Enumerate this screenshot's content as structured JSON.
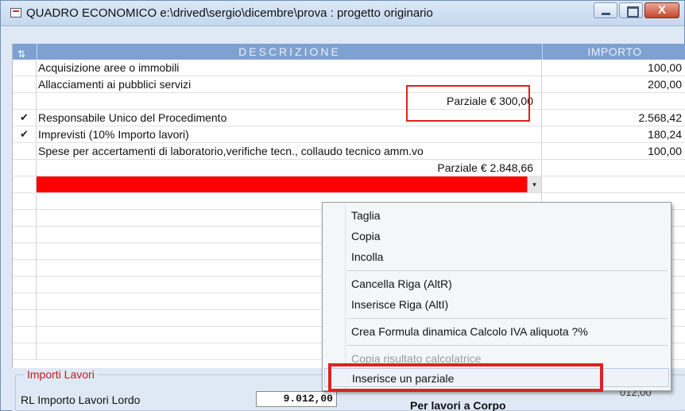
{
  "window": {
    "title": "QUADRO ECONOMICO  e:\\drived\\sergio\\dicembre\\prova : progetto originario",
    "close_glyph": "X"
  },
  "grid": {
    "headers": {
      "description": "DESCRIZIONE",
      "amount": "IMPORTO"
    },
    "rows": [
      {
        "check": "",
        "description": "Acquisizione aree o immobili",
        "amount": "100,00"
      },
      {
        "check": "",
        "description": "Allacciamenti ai pubblici servizi",
        "amount": "200,00"
      },
      {
        "check": "",
        "description": "Parziale  € 300,00",
        "amount": ""
      },
      {
        "check": "✔",
        "description": "Responsabile Unico del Procedimento",
        "amount": "2.568,42"
      },
      {
        "check": "✔",
        "description": "Imprevisti (10% Importo lavori)",
        "amount": "180,24"
      },
      {
        "check": "",
        "description": "Spese per accertamenti di laboratorio,verifiche tecn., collaudo tecnico amm.vo",
        "amount": "100,00"
      },
      {
        "check": "",
        "description": "Parziale  € 2.848,66",
        "amount": ""
      }
    ],
    "dropdown_glyph": "▾"
  },
  "context_menu": {
    "items": [
      {
        "label": "Taglia",
        "enabled": true
      },
      {
        "label": "Copia",
        "enabled": true
      },
      {
        "label": "Incolla",
        "enabled": true
      },
      {
        "label": "Cancella Riga  (AltR)",
        "enabled": true
      },
      {
        "label": "Inserisce Riga (AltI)",
        "enabled": true
      },
      {
        "label": "Crea Formula dinamica Calcolo IVA aliquota ?%",
        "enabled": true
      },
      {
        "label": "Copia risultato calcolatrice",
        "enabled": false
      },
      {
        "label": "Inserisce un parziale",
        "enabled": true,
        "highlighted": true
      }
    ]
  },
  "bottom": {
    "group_title": "Importi Lavori",
    "rl_label": "RL  Importo  Lavori  Lordo",
    "rl_value": "9.012,00",
    "corpo_label": "Per lavori a Corpo",
    "right_partial": "012,00"
  },
  "colors": {
    "header_bg": "#7fa1d2",
    "selected_row": "#ff0000",
    "highlight_box": "#dd2222",
    "group_title": "#c21b1b"
  }
}
